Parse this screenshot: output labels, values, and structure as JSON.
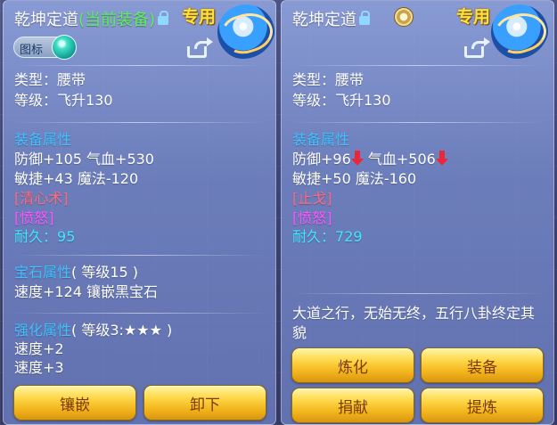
{
  "left_panel": {
    "title": "乾坤定道",
    "current_tag": "(当前装备)",
    "exclusive": "专用",
    "badge_label": "图标",
    "type_line": "类型：腰带",
    "level_line": "等级：飞升130",
    "attr_title": "装备属性",
    "attr_line1": "防御+105 气血+530",
    "attr_line2": "敏捷+43 魔法-120",
    "skill": "[清心术]",
    "effect": "[愤怒]",
    "durability_label": "耐久：",
    "durability_value": "95",
    "gem_title": "宝石属性",
    "gem_level": "( 等级15 )",
    "gem_line": "速度+124 镶嵌黑宝石",
    "enhance_title": "强化属性",
    "enhance_level": "( 等级3:★★★ )",
    "enhance_line1": "速度+2",
    "enhance_line2": "速度+3",
    "btn_inlay": "镶嵌",
    "btn_unequip": "卸下"
  },
  "right_panel": {
    "title": "乾坤定道",
    "exclusive": "专用",
    "type_line": "类型：腰带",
    "level_line": "等级：飞升130",
    "attr_title": "装备属性",
    "attr_def": "防御+96",
    "attr_hp": "气血+506",
    "attr_line2": "敏捷+50 魔法-160",
    "skill": "[止戈]",
    "effect": "[愤怒]",
    "durability_label": "耐久：",
    "durability_value": "729",
    "description": "大道之行，无始无终，五行八卦终定其貌",
    "btn_refine": "炼化",
    "btn_equip": "装备",
    "btn_donate": "捐献",
    "btn_extract": "提炼"
  },
  "colors": {
    "section_title": "#3fc0ff",
    "skill": "#ff6a80",
    "effect": "#ff55ff",
    "durability": "#3fe6ff",
    "current_tag": "#5cf05c",
    "exclusive": "#ffe23a",
    "decrease_arrow": "#e8283a"
  }
}
